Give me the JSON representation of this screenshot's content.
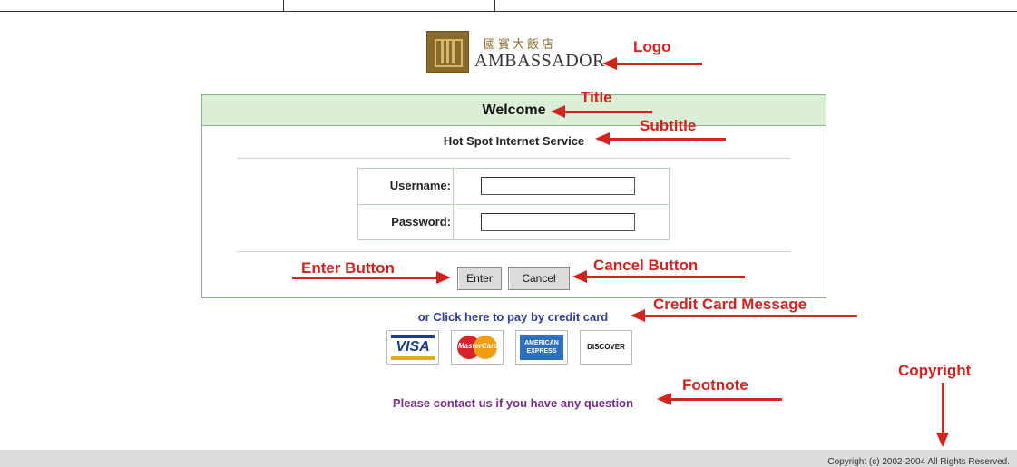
{
  "logo": {
    "chinese": "國賓大飯店",
    "text": "AMBASSADOR"
  },
  "panel": {
    "title": "Welcome",
    "subtitle": "Hot Spot Internet Service",
    "username_label": "Username:",
    "password_label": "Password:",
    "username_value": "",
    "password_value": "",
    "enter_label": "Enter",
    "cancel_label": "Cancel"
  },
  "credit_card_message": "or Click here to pay by credit card",
  "cards": {
    "visa": "VISA",
    "mastercard": "MasterCard",
    "amex": "AMERICAN EXPRESS",
    "discover": "DISCOVER"
  },
  "footnote": "Please contact us if you have any question",
  "copyright": "Copyright (c) 2002-2004 All Rights Reserved.",
  "annotations": {
    "logo": "Logo",
    "title": "Title",
    "subtitle": "Subtitle",
    "enter_button": "Enter Button",
    "cancel_button": "Cancel Button",
    "credit_card_message": "Credit Card Message",
    "footnote": "Footnote",
    "copyright": "Copyright"
  },
  "colors": {
    "accent_green": "#dbeed6",
    "annotation_red": "#d3231f",
    "link_blue": "#2f3b9a",
    "footnote_purple": "#7a2a8a",
    "logo_gold": "#8a6a2a"
  }
}
